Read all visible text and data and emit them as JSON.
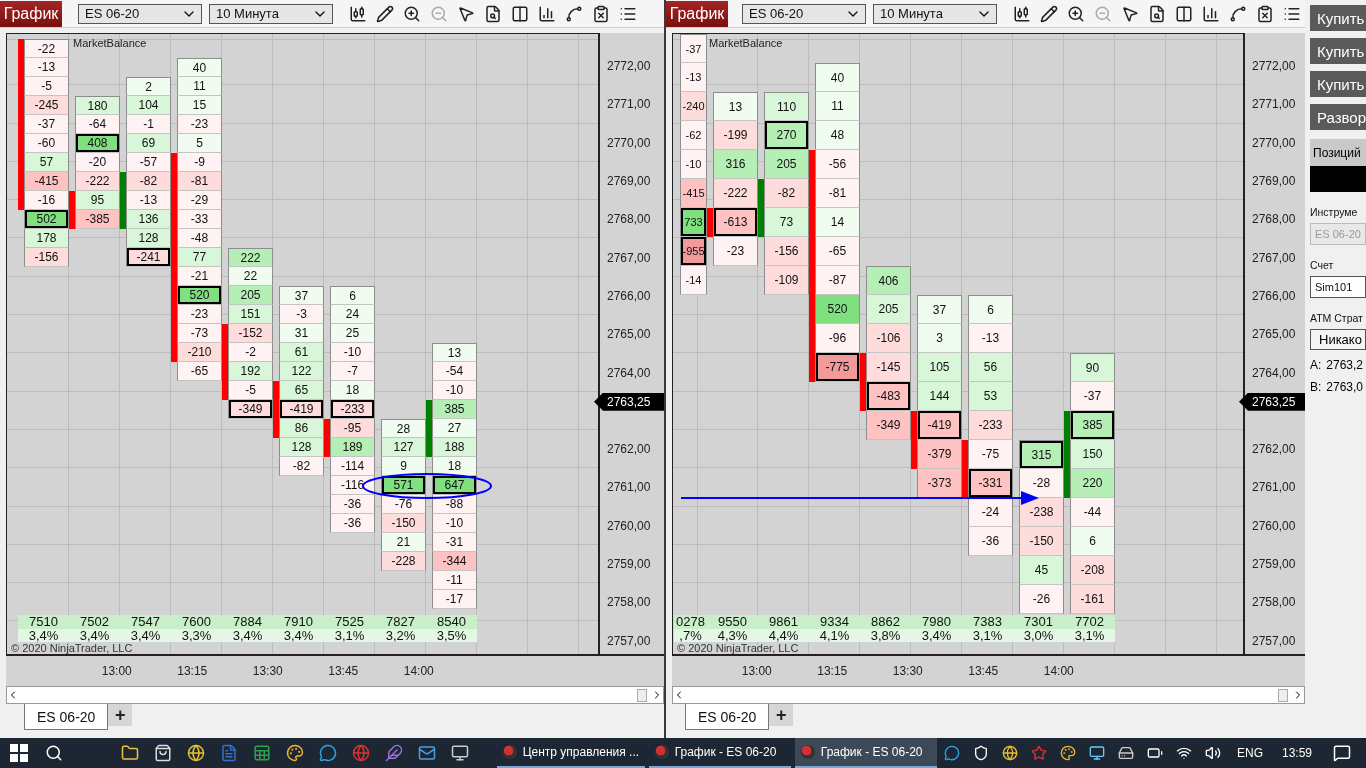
{
  "charts": [
    {
      "toolbar": {
        "title_button": "График",
        "instrument": "ES 06-20",
        "interval": "10 Минута"
      },
      "indicator_label": "MarketBalance",
      "columns": [
        {
          "partial": false,
          "color": "#ff0000",
          "volume": "7510",
          "percent": "3,4%",
          "cells": [
            {
              "value": "-22",
              "color": "#fff2f2",
              "boxed": false,
              "bar": true
            },
            {
              "value": "-13",
              "color": "#fff2f2",
              "boxed": false,
              "bar": true
            },
            {
              "value": "-5",
              "color": "#fff2f2",
              "boxed": false,
              "bar": true
            },
            {
              "value": "-245",
              "color": "#ffdcdc",
              "boxed": false,
              "bar": true
            },
            {
              "value": "-37",
              "color": "#fff2f2",
              "boxed": false,
              "bar": true
            },
            {
              "value": "-60",
              "color": "#fff2f2",
              "boxed": false,
              "bar": true
            },
            {
              "value": "57",
              "color": "#d8f6d8",
              "boxed": false,
              "bar": true
            },
            {
              "value": "-415",
              "color": "#ffc2c2",
              "boxed": false,
              "bar": true
            },
            {
              "value": "-16",
              "color": "#fff2f2",
              "boxed": false,
              "bar": true
            },
            {
              "value": "502",
              "color": "#80e080",
              "boxed": true,
              "bar": false
            },
            {
              "value": "178",
              "color": "#d8f6d8",
              "boxed": false,
              "bar": false
            },
            {
              "value": "-156",
              "color": "#ffdcdc",
              "boxed": false,
              "bar": false
            }
          ]
        },
        {
          "partial": false,
          "color": "#ff0000",
          "volume": "7502",
          "percent": "3,4%",
          "cells": [
            null,
            null,
            null,
            {
              "value": "180",
              "color": "#d8f6d8",
              "boxed": false,
              "bar": false
            },
            {
              "value": "-64",
              "color": "#fff2f2",
              "boxed": false,
              "bar": false
            },
            {
              "value": "408",
              "color": "#80e080",
              "boxed": true,
              "bar": false
            },
            {
              "value": "-20",
              "color": "#fff2f2",
              "boxed": false,
              "bar": false
            },
            {
              "value": "-222",
              "color": "#ffdcdc",
              "boxed": false,
              "bar": false
            },
            {
              "value": "95",
              "color": "#d8f6d8",
              "boxed": false,
              "bar": true
            },
            {
              "value": "-385",
              "color": "#ffc2c2",
              "boxed": false,
              "bar": true
            }
          ]
        },
        {
          "partial": false,
          "color": "#008000",
          "volume": "7547",
          "percent": "3,4%",
          "cells": [
            null,
            null,
            {
              "value": "2",
              "color": "#effcef",
              "boxed": false,
              "bar": false
            },
            {
              "value": "104",
              "color": "#d8f6d8",
              "boxed": false,
              "bar": false
            },
            {
              "value": "-1",
              "color": "#fff2f2",
              "boxed": false,
              "bar": false
            },
            {
              "value": "69",
              "color": "#d8f6d8",
              "boxed": false,
              "bar": false
            },
            {
              "value": "-57",
              "color": "#fff2f2",
              "boxed": false,
              "bar": false
            },
            {
              "value": "-82",
              "color": "#ffdcdc",
              "boxed": false,
              "bar": true
            },
            {
              "value": "-13",
              "color": "#fff2f2",
              "boxed": false,
              "bar": true
            },
            {
              "value": "136",
              "color": "#d8f6d8",
              "boxed": false,
              "bar": true
            },
            {
              "value": "128",
              "color": "#d8f6d8",
              "boxed": false,
              "bar": false
            },
            {
              "value": "-241",
              "color": "#ffdcdc",
              "boxed": true,
              "bar": false
            }
          ]
        },
        {
          "partial": false,
          "color": "#ff0000",
          "volume": "7600",
          "percent": "3,3%",
          "cells": [
            null,
            {
              "value": "40",
              "color": "#effcef",
              "boxed": false,
              "bar": false
            },
            {
              "value": "11",
              "color": "#effcef",
              "boxed": false,
              "bar": false
            },
            {
              "value": "15",
              "color": "#effcef",
              "boxed": false,
              "bar": false
            },
            {
              "value": "-23",
              "color": "#fff2f2",
              "boxed": false,
              "bar": false
            },
            {
              "value": "5",
              "color": "#effcef",
              "boxed": false,
              "bar": false
            },
            {
              "value": "-9",
              "color": "#fff2f2",
              "boxed": false,
              "bar": true
            },
            {
              "value": "-81",
              "color": "#ffdcdc",
              "boxed": false,
              "bar": true
            },
            {
              "value": "-29",
              "color": "#fff2f2",
              "boxed": false,
              "bar": true
            },
            {
              "value": "-33",
              "color": "#fff2f2",
              "boxed": false,
              "bar": true
            },
            {
              "value": "-48",
              "color": "#fff2f2",
              "boxed": false,
              "bar": true
            },
            {
              "value": "77",
              "color": "#d8f6d8",
              "boxed": false,
              "bar": true
            },
            {
              "value": "-21",
              "color": "#fff2f2",
              "boxed": false,
              "bar": true
            },
            {
              "value": "520",
              "color": "#80e080",
              "boxed": true,
              "bar": true
            },
            {
              "value": "-23",
              "color": "#fff2f2",
              "boxed": false,
              "bar": true
            },
            {
              "value": "-73",
              "color": "#fff2f2",
              "boxed": false,
              "bar": true
            },
            {
              "value": "-210",
              "color": "#ffdcdc",
              "boxed": false,
              "bar": true
            },
            {
              "value": "-65",
              "color": "#fff2f2",
              "boxed": false,
              "bar": false
            }
          ]
        },
        {
          "partial": false,
          "color": "#ff0000",
          "volume": "7884",
          "percent": "3,4%",
          "cells": [
            null,
            null,
            null,
            null,
            null,
            null,
            null,
            null,
            null,
            null,
            null,
            {
              "value": "222",
              "color": "#b6efb6",
              "boxed": false,
              "bar": false
            },
            {
              "value": "22",
              "color": "#effcef",
              "boxed": false,
              "bar": false
            },
            {
              "value": "205",
              "color": "#b6efb6",
              "boxed": false,
              "bar": false
            },
            {
              "value": "151",
              "color": "#d8f6d8",
              "boxed": false,
              "bar": false
            },
            {
              "value": "-152",
              "color": "#ffdcdc",
              "boxed": false,
              "bar": true
            },
            {
              "value": "-2",
              "color": "#fff2f2",
              "boxed": false,
              "bar": true
            },
            {
              "value": "192",
              "color": "#d8f6d8",
              "boxed": false,
              "bar": true
            },
            {
              "value": "-5",
              "color": "#fff2f2",
              "boxed": false,
              "bar": true
            },
            {
              "value": "-349",
              "color": "#ffdcdc",
              "boxed": true,
              "bar": false
            }
          ]
        },
        {
          "partial": false,
          "color": "#ff0000",
          "volume": "7910",
          "percent": "3,4%",
          "cells": [
            null,
            null,
            null,
            null,
            null,
            null,
            null,
            null,
            null,
            null,
            null,
            null,
            null,
            {
              "value": "37",
              "color": "#effcef",
              "boxed": false,
              "bar": false
            },
            {
              "value": "-3",
              "color": "#fff2f2",
              "boxed": false,
              "bar": false
            },
            {
              "value": "31",
              "color": "#effcef",
              "boxed": false,
              "bar": false
            },
            {
              "value": "61",
              "color": "#d8f6d8",
              "boxed": false,
              "bar": false
            },
            {
              "value": "122",
              "color": "#d8f6d8",
              "boxed": false,
              "bar": false
            },
            {
              "value": "65",
              "color": "#d8f6d8",
              "boxed": false,
              "bar": true
            },
            {
              "value": "-419",
              "color": "#ffdcdc",
              "boxed": true,
              "bar": true
            },
            {
              "value": "86",
              "color": "#d8f6d8",
              "boxed": false,
              "bar": true
            },
            {
              "value": "128",
              "color": "#d8f6d8",
              "boxed": false,
              "bar": false
            },
            {
              "value": "-82",
              "color": "#fff2f2",
              "boxed": false,
              "bar": false
            }
          ]
        },
        {
          "partial": false,
          "color": "#ff0000",
          "volume": "7525",
          "percent": "3,1%",
          "cells": [
            null,
            null,
            null,
            null,
            null,
            null,
            null,
            null,
            null,
            null,
            null,
            null,
            null,
            {
              "value": "6",
              "color": "#effcef",
              "boxed": false,
              "bar": false
            },
            {
              "value": "24",
              "color": "#effcef",
              "boxed": false,
              "bar": false
            },
            {
              "value": "25",
              "color": "#effcef",
              "boxed": false,
              "bar": false
            },
            {
              "value": "-10",
              "color": "#fff2f2",
              "boxed": false,
              "bar": false
            },
            {
              "value": "-7",
              "color": "#fff2f2",
              "boxed": false,
              "bar": false
            },
            {
              "value": "18",
              "color": "#effcef",
              "boxed": false,
              "bar": false
            },
            {
              "value": "-233",
              "color": "#ffdcdc",
              "boxed": true,
              "bar": false
            },
            {
              "value": "-95",
              "color": "#ffdcdc",
              "boxed": false,
              "bar": true
            },
            {
              "value": "189",
              "color": "#b6efb6",
              "boxed": false,
              "bar": true
            },
            {
              "value": "-114",
              "color": "#fff2f2",
              "boxed": false,
              "bar": false
            },
            {
              "value": "-116",
              "color": "#fff2f2",
              "boxed": false,
              "bar": false
            },
            {
              "value": "-36",
              "color": "#fff2f2",
              "boxed": false,
              "bar": false
            },
            {
              "value": "-36",
              "color": "#fff2f2",
              "boxed": false,
              "bar": false
            }
          ]
        },
        {
          "partial": false,
          "volume": "7827",
          "percent": "3,2%",
          "cells": [
            null,
            null,
            null,
            null,
            null,
            null,
            null,
            null,
            null,
            null,
            null,
            null,
            null,
            null,
            null,
            null,
            null,
            null,
            null,
            null,
            {
              "value": "28",
              "color": "#effcef",
              "boxed": false,
              "bar": false
            },
            {
              "value": "127",
              "color": "#d8f6d8",
              "boxed": false,
              "bar": false
            },
            {
              "value": "9",
              "color": "#effcef",
              "boxed": false,
              "bar": false
            },
            {
              "value": "571",
              "color": "#80e080",
              "boxed": true,
              "bar": false
            },
            {
              "value": "-76",
              "color": "#fff2f2",
              "boxed": false,
              "bar": false
            },
            {
              "value": "-150",
              "color": "#ffdcdc",
              "boxed": false,
              "bar": false
            },
            {
              "value": "21",
              "color": "#effcef",
              "boxed": false,
              "bar": false
            },
            {
              "value": "-228",
              "color": "#ffdcdc",
              "boxed": false,
              "bar": false
            }
          ]
        },
        {
          "partial": false,
          "color": "#008000",
          "volume": "8540",
          "percent": "3,5%",
          "cells": [
            null,
            null,
            null,
            null,
            null,
            null,
            null,
            null,
            null,
            null,
            null,
            null,
            null,
            null,
            null,
            null,
            {
              "value": "13",
              "color": "#effcef",
              "boxed": false,
              "bar": false
            },
            {
              "value": "-54",
              "color": "#fff2f2",
              "boxed": false,
              "bar": false
            },
            {
              "value": "-10",
              "color": "#fff2f2",
              "boxed": false,
              "bar": false
            },
            {
              "value": "385",
              "color": "#b6efb6",
              "boxed": false,
              "bar": true
            },
            {
              "value": "27",
              "color": "#effcef",
              "boxed": false,
              "bar": true
            },
            {
              "value": "188",
              "color": "#d8f6d8",
              "boxed": false,
              "bar": true
            },
            {
              "value": "18",
              "color": "#effcef",
              "boxed": false,
              "bar": false
            },
            {
              "value": "647",
              "color": "#80e080",
              "boxed": true,
              "bar": false
            },
            {
              "value": "-88",
              "color": "#fff2f2",
              "boxed": false,
              "bar": false
            },
            {
              "value": "-10",
              "color": "#fff2f2",
              "boxed": false,
              "bar": false
            },
            {
              "value": "-31",
              "color": "#fff2f2",
              "boxed": false,
              "bar": false
            },
            {
              "value": "-344",
              "color": "#ffc2c2",
              "boxed": false,
              "bar": false
            },
            {
              "value": "-11",
              "color": "#fff2f2",
              "boxed": false,
              "bar": false
            },
            {
              "value": "-17",
              "color": "#fff2f2",
              "boxed": false,
              "bar": false
            }
          ]
        }
      ],
      "price_axis": {
        "labels_above": [
          "2772,00",
          "2771,00",
          "2770,00",
          "2769,00",
          "2768,00",
          "2767,00",
          "2766,00",
          "2765,00",
          "2764,00"
        ],
        "current_price": "2763,25",
        "labels_below": [
          "2762,00",
          "2761,00",
          "2760,00",
          "2759,00",
          "2758,00",
          "2757,00"
        ]
      },
      "time_axis": [
        "13:00",
        "13:15",
        "13:30",
        "13:45",
        "14:00"
      ],
      "copyright": "© 2020 NinjaTrader, LLC",
      "drawing": {
        "kind": "ellipse"
      },
      "tabs": [
        {
          "label": "ES 06-20",
          "selected": true
        }
      ],
      "add_tab": "+"
    },
    {
      "toolbar": {
        "title_button": "График",
        "instrument": "ES 06-20",
        "interval": "10 Минута"
      },
      "indicator_label": "MarketBalance",
      "columns": [
        {
          "partial": true,
          "volume": "0278",
          "percent": ",7%",
          "cells": [
            {
              "value": "-37",
              "color": "#fff2f2",
              "boxed": false,
              "bar": false
            },
            {
              "value": "-13",
              "color": "#fff2f2",
              "boxed": false,
              "bar": false
            },
            {
              "value": "-240",
              "color": "#ffdcdc",
              "boxed": false,
              "bar": false
            },
            {
              "value": "-62",
              "color": "#fff2f2",
              "boxed": false,
              "bar": false
            },
            {
              "value": "-10",
              "color": "#fff2f2",
              "boxed": false,
              "bar": false
            },
            {
              "value": "-415",
              "color": "#ffc2c2",
              "boxed": false,
              "bar": false
            },
            {
              "value": "733",
              "color": "#80e080",
              "boxed": true,
              "bar": false
            },
            {
              "value": "-955",
              "color": "#f29a9a",
              "boxed": true,
              "bar": false
            },
            {
              "value": "-14",
              "color": "#fff2f2",
              "boxed": false,
              "bar": false
            }
          ]
        },
        {
          "partial": false,
          "color": "#ff0000",
          "volume": "9550",
          "percent": "4,3%",
          "cells": [
            null,
            null,
            {
              "value": "13",
              "color": "#effcef",
              "boxed": false,
              "bar": false
            },
            {
              "value": "-199",
              "color": "#ffdcdc",
              "boxed": false,
              "bar": false
            },
            {
              "value": "316",
              "color": "#b6efb6",
              "boxed": false,
              "bar": false
            },
            {
              "value": "-222",
              "color": "#ffdcdc",
              "boxed": false,
              "bar": false
            },
            {
              "value": "-613",
              "color": "#ffc2c2",
              "boxed": true,
              "bar": true
            },
            {
              "value": "-23",
              "color": "#fff2f2",
              "boxed": false,
              "bar": false
            }
          ]
        },
        {
          "partial": false,
          "color": "#008000",
          "volume": "9861",
          "percent": "4,4%",
          "cells": [
            null,
            null,
            {
              "value": "110",
              "color": "#d8f6d8",
              "boxed": false,
              "bar": false
            },
            {
              "value": "270",
              "color": "#b6efb6",
              "boxed": true,
              "bar": false
            },
            {
              "value": "205",
              "color": "#b6efb6",
              "boxed": false,
              "bar": false
            },
            {
              "value": "-82",
              "color": "#ffdcdc",
              "boxed": false,
              "bar": true
            },
            {
              "value": "73",
              "color": "#d8f6d8",
              "boxed": false,
              "bar": true
            },
            {
              "value": "-156",
              "color": "#ffdcdc",
              "boxed": false,
              "bar": false
            },
            {
              "value": "-109",
              "color": "#ffdcdc",
              "boxed": false,
              "bar": false
            }
          ]
        },
        {
          "partial": false,
          "color": "#ff0000",
          "volume": "9334",
          "percent": "4,1%",
          "cells": [
            null,
            {
              "value": "40",
              "color": "#effcef",
              "boxed": false,
              "bar": false
            },
            {
              "value": "11",
              "color": "#effcef",
              "boxed": false,
              "bar": false
            },
            {
              "value": "48",
              "color": "#effcef",
              "boxed": false,
              "bar": false
            },
            {
              "value": "-56",
              "color": "#fff2f2",
              "boxed": false,
              "bar": true
            },
            {
              "value": "-81",
              "color": "#fff2f2",
              "boxed": false,
              "bar": true
            },
            {
              "value": "14",
              "color": "#effcef",
              "boxed": false,
              "bar": true
            },
            {
              "value": "-65",
              "color": "#fff2f2",
              "boxed": false,
              "bar": true
            },
            {
              "value": "-87",
              "color": "#fff2f2",
              "boxed": false,
              "bar": true
            },
            {
              "value": "520",
              "color": "#80e080",
              "boxed": false,
              "bar": true
            },
            {
              "value": "-96",
              "color": "#fff2f2",
              "boxed": false,
              "bar": true
            },
            {
              "value": "-775",
              "color": "#f29a9a",
              "boxed": true,
              "bar": true
            }
          ]
        },
        {
          "partial": false,
          "color": "#ff0000",
          "volume": "8862",
          "percent": "3,8%",
          "cells": [
            null,
            null,
            null,
            null,
            null,
            null,
            null,
            null,
            {
              "value": "406",
              "color": "#b6efb6",
              "boxed": false,
              "bar": false
            },
            {
              "value": "205",
              "color": "#d8f6d8",
              "boxed": false,
              "bar": false
            },
            {
              "value": "-106",
              "color": "#ffdcdc",
              "boxed": false,
              "bar": false
            },
            {
              "value": "-145",
              "color": "#ffdcdc",
              "boxed": false,
              "bar": true
            },
            {
              "value": "-483",
              "color": "#ffc2c2",
              "boxed": true,
              "bar": true
            },
            {
              "value": "-349",
              "color": "#ffc2c2",
              "boxed": false,
              "bar": false
            }
          ]
        },
        {
          "partial": false,
          "color": "#ff0000",
          "volume": "7980",
          "percent": "3,4%",
          "cells": [
            null,
            null,
            null,
            null,
            null,
            null,
            null,
            null,
            null,
            {
              "value": "37",
              "color": "#effcef",
              "boxed": false,
              "bar": false
            },
            {
              "value": "3",
              "color": "#effcef",
              "boxed": false,
              "bar": false
            },
            {
              "value": "105",
              "color": "#d8f6d8",
              "boxed": false,
              "bar": false
            },
            {
              "value": "144",
              "color": "#d8f6d8",
              "boxed": false,
              "bar": false
            },
            {
              "value": "-419",
              "color": "#ffc2c2",
              "boxed": true,
              "bar": true
            },
            {
              "value": "-379",
              "color": "#ffc2c2",
              "boxed": false,
              "bar": true
            },
            {
              "value": "-373",
              "color": "#ffc2c2",
              "boxed": false,
              "bar": false
            }
          ]
        },
        {
          "partial": false,
          "color": "#ff0000",
          "volume": "7383",
          "percent": "3,1%",
          "cells": [
            null,
            null,
            null,
            null,
            null,
            null,
            null,
            null,
            null,
            {
              "value": "6",
              "color": "#effcef",
              "boxed": false,
              "bar": false
            },
            {
              "value": "-13",
              "color": "#fff2f2",
              "boxed": false,
              "bar": false
            },
            {
              "value": "56",
              "color": "#d8f6d8",
              "boxed": false,
              "bar": false
            },
            {
              "value": "53",
              "color": "#d8f6d8",
              "boxed": false,
              "bar": false
            },
            {
              "value": "-233",
              "color": "#ffdcdc",
              "boxed": false,
              "bar": false
            },
            {
              "value": "-75",
              "color": "#fff2f2",
              "boxed": false,
              "bar": true
            },
            {
              "value": "-331",
              "color": "#ffc2c2",
              "boxed": true,
              "bar": true
            },
            {
              "value": "-24",
              "color": "#fff2f2",
              "boxed": false,
              "bar": false
            },
            {
              "value": "-36",
              "color": "#fff2f2",
              "boxed": false,
              "bar": false
            }
          ]
        },
        {
          "partial": false,
          "volume": "7301",
          "percent": "3,0%",
          "cells": [
            null,
            null,
            null,
            null,
            null,
            null,
            null,
            null,
            null,
            null,
            null,
            null,
            null,
            null,
            {
              "value": "315",
              "color": "#b6efb6",
              "boxed": true,
              "bar": false
            },
            {
              "value": "-28",
              "color": "#fff2f2",
              "boxed": false,
              "bar": false
            },
            {
              "value": "-238",
              "color": "#ffdcdc",
              "boxed": false,
              "bar": false
            },
            {
              "value": "-150",
              "color": "#ffdcdc",
              "boxed": false,
              "bar": false
            },
            {
              "value": "45",
              "color": "#d8f6d8",
              "boxed": false,
              "bar": false
            },
            {
              "value": "-26",
              "color": "#fff2f2",
              "boxed": false,
              "bar": false
            }
          ]
        },
        {
          "partial": false,
          "color": "#008000",
          "volume": "7702",
          "percent": "3,1%",
          "cells": [
            null,
            null,
            null,
            null,
            null,
            null,
            null,
            null,
            null,
            null,
            null,
            {
              "value": "90",
              "color": "#d8f6d8",
              "boxed": false,
              "bar": false
            },
            {
              "value": "-37",
              "color": "#fff2f2",
              "boxed": false,
              "bar": false
            },
            {
              "value": "385",
              "color": "#b6efb6",
              "boxed": true,
              "bar": true
            },
            {
              "value": "150",
              "color": "#d8f6d8",
              "boxed": false,
              "bar": true
            },
            {
              "value": "220",
              "color": "#b6efb6",
              "boxed": false,
              "bar": true
            },
            {
              "value": "-44",
              "color": "#fff2f2",
              "boxed": false,
              "bar": false
            },
            {
              "value": "6",
              "color": "#effcef",
              "boxed": false,
              "bar": false
            },
            {
              "value": "-208",
              "color": "#ffdcdc",
              "boxed": false,
              "bar": false
            },
            {
              "value": "-161",
              "color": "#ffdcdc",
              "boxed": false,
              "bar": false
            }
          ]
        }
      ],
      "price_axis": {
        "labels_above": [
          "2772,00",
          "2771,00",
          "2770,00",
          "2769,00",
          "2768,00",
          "2767,00",
          "2766,00",
          "2765,00",
          "2764,00"
        ],
        "current_price": "2763,25",
        "labels_below": [
          "2762,00",
          "2761,00",
          "2760,00",
          "2759,00",
          "2758,00",
          "2757,00"
        ]
      },
      "time_axis": [
        "13:00",
        "13:15",
        "13:30",
        "13:45",
        "14:00"
      ],
      "copyright": "© 2020 NinjaTrader, LLC",
      "drawing": {
        "kind": "arrow"
      },
      "tabs": [
        {
          "label": "ES 06-20",
          "selected": true
        }
      ],
      "add_tab": "+",
      "order_panel": {
        "buttons": [
          "Купить",
          "Купить",
          "Купить",
          "Развор"
        ],
        "positions_header": "Позиций",
        "instrument_label": "Инструме",
        "instrument": {
          "value": "ES 06-20",
          "disabled": true
        },
        "account_label": "Счет",
        "account": {
          "value": "Sim101",
          "disabled": false
        },
        "atm_label": "АТМ Страт",
        "atm": "Никако",
        "ask_label": "A:",
        "ask": "2763,2",
        "bid_label": "B:",
        "bid": "2763,0"
      }
    }
  ],
  "taskbar": {
    "tasks": [
      {
        "label": "Центр управления ...",
        "selected": false
      },
      {
        "label": "График - ES 06-20",
        "selected": false
      },
      {
        "label": "График - ES 06-20",
        "selected": true
      }
    ],
    "language": "ENG",
    "clock": "13:59"
  }
}
